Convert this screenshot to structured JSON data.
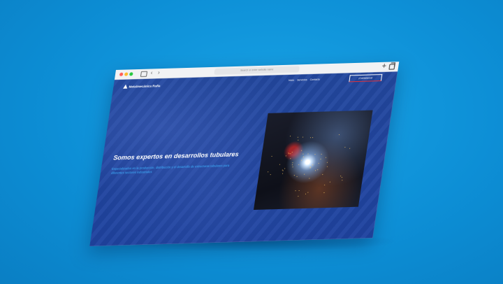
{
  "browser": {
    "address_placeholder": "Search or enter website name"
  },
  "site": {
    "logo_text": "Metalmecánica Raña",
    "nav": [
      "Inicio",
      "Servicios",
      "Contacto"
    ],
    "cta_label": "¡Contáctanos!",
    "hero_title": "Somos expertos en desarrollos tubulares",
    "hero_subtitle": "Especializados en la producción, distribución y el desarrollo de estructuras tubulares para diferentes sectores industriales"
  }
}
